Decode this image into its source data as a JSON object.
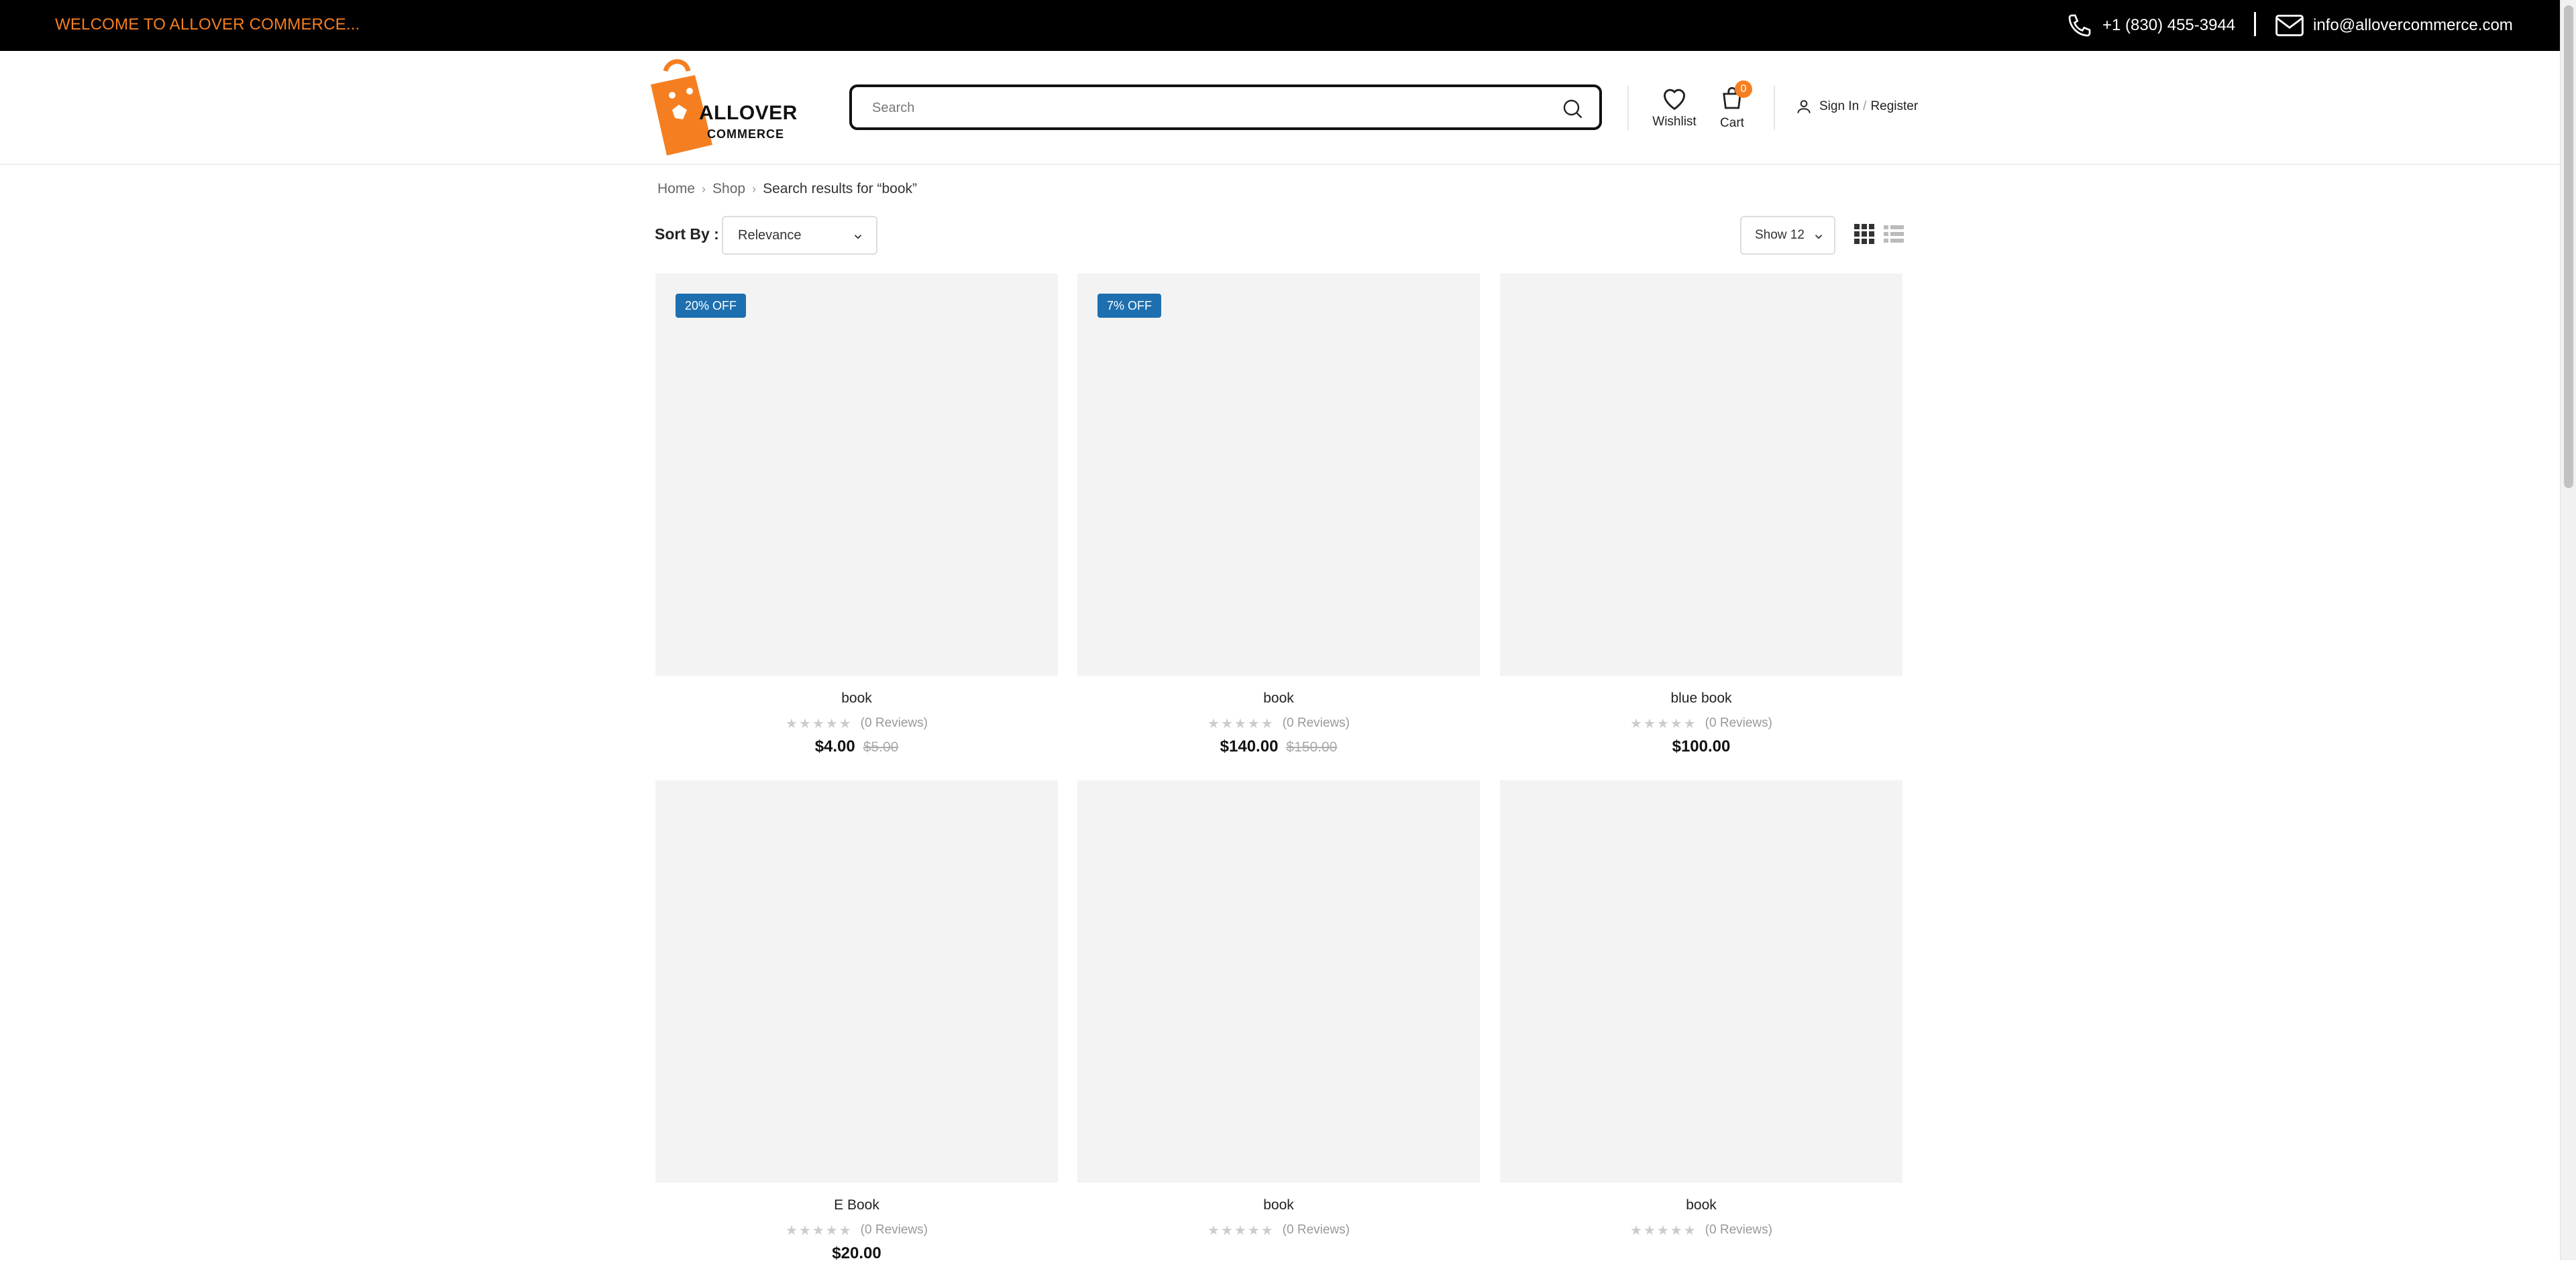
{
  "topbar": {
    "welcome": "WELCOME TO ALLOVER COMMERCE...",
    "phone": "+1 (830) 455-3944",
    "email": "info@allovercommerce.com"
  },
  "header": {
    "logo": {
      "line1": "ALLOVER",
      "line2": "COMMERCE"
    },
    "search": {
      "placeholder": "Search"
    },
    "wishlist_label": "Wishlist",
    "cart_label": "Cart",
    "cart_count": "0",
    "sign_in": "Sign In",
    "separator": "/",
    "register": "Register"
  },
  "breadcrumb": {
    "items": [
      "Home",
      "Shop"
    ],
    "current": "Search results for “book”"
  },
  "toolbar": {
    "sort_label": "Sort By :",
    "sort_value": "Relevance",
    "show_value": "Show 12"
  },
  "products": [
    {
      "name": "book",
      "reviews": "(0 Reviews)",
      "price": "$4.00",
      "old_price": "$5.00",
      "badge": "20% OFF"
    },
    {
      "name": "book",
      "reviews": "(0 Reviews)",
      "price": "$140.00",
      "old_price": "$150.00",
      "badge": "7% OFF"
    },
    {
      "name": "blue book",
      "reviews": "(0 Reviews)",
      "price": "$100.00",
      "old_price": "",
      "badge": ""
    },
    {
      "name": "E Book",
      "reviews": "(0 Reviews)",
      "price": "$20.00",
      "old_price": "",
      "badge": ""
    },
    {
      "name": "book",
      "reviews": "(0 Reviews)",
      "price": "",
      "old_price": "",
      "badge": ""
    },
    {
      "name": "book",
      "reviews": "(0 Reviews)",
      "price": "",
      "old_price": "",
      "badge": ""
    }
  ],
  "colors": {
    "accent": "#f57f20",
    "badge": "#1d6fb0",
    "topbar": "#000000"
  },
  "icons": [
    "phone-icon",
    "mail-icon",
    "search-icon",
    "heart-icon",
    "bag-icon",
    "user-icon",
    "chevron-down-icon",
    "grid-view-icon",
    "list-view-icon",
    "star-icon"
  ]
}
